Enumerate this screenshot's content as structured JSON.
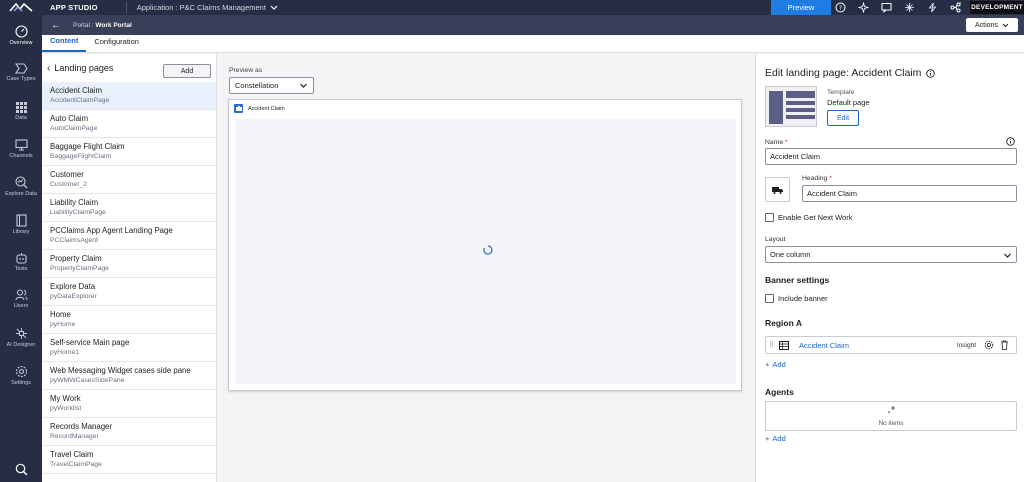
{
  "topbar": {
    "studio": "APP STUDIO",
    "application": "Application : P&C Claims Management",
    "preview": "Preview",
    "environment": "DEVELOPMENT"
  },
  "leftnav": [
    {
      "label": "Overview",
      "icon": "overview-icon"
    },
    {
      "label": "Case Types",
      "icon": "case-types-icon"
    },
    {
      "label": "Data",
      "icon": "data-icon"
    },
    {
      "label": "Channels",
      "icon": "channels-icon"
    },
    {
      "label": "Explore Data",
      "icon": "explore-data-icon"
    },
    {
      "label": "Library",
      "icon": "library-icon"
    },
    {
      "label": "Tests",
      "icon": "tests-icon"
    },
    {
      "label": "Users",
      "icon": "users-icon"
    },
    {
      "label": "AI Designer",
      "icon": "ai-designer-icon"
    },
    {
      "label": "Settings",
      "icon": "settings-icon"
    }
  ],
  "subheader": {
    "portal_prefix": "Portal : ",
    "portal_name": "Work Portal",
    "actions": "Actions"
  },
  "tabs": [
    {
      "label": "Content",
      "active": true
    },
    {
      "label": "Configuration",
      "active": false
    }
  ],
  "landing_pages": {
    "title": "Landing pages",
    "add": "Add",
    "items": [
      {
        "name": "Accident Claim",
        "id": "AccidentClaimPage"
      },
      {
        "name": "Auto Claim",
        "id": "AutoClaimPage"
      },
      {
        "name": "Baggage Flight Claim",
        "id": "BaggageFlightClaim"
      },
      {
        "name": "Customer",
        "id": "Customer_2"
      },
      {
        "name": "Liability Claim",
        "id": "LiabilityClaimPage"
      },
      {
        "name": "PCClaims App Agent Landing Page",
        "id": "PCClaimsAgent"
      },
      {
        "name": "Property Claim",
        "id": "PropertyClaimPage"
      },
      {
        "name": "Explore Data",
        "id": "pyDataExplorer"
      },
      {
        "name": "Home",
        "id": "pyHome"
      },
      {
        "name": "Self-service Main page",
        "id": "pyHome1"
      },
      {
        "name": "Web Messaging Widget cases side pane",
        "id": "pyWMWCasesSidePane"
      },
      {
        "name": "My Work",
        "id": "pyWorklist"
      },
      {
        "name": "Records Manager",
        "id": "RecordManager"
      },
      {
        "name": "Travel Claim",
        "id": "TravelClaimPage"
      }
    ]
  },
  "preview": {
    "label": "Preview as",
    "selected": "Constellation",
    "frame_title": "Accident Claim"
  },
  "edit": {
    "title": "Edit landing page: Accident Claim",
    "template_label": "Template",
    "template_value": "Default page",
    "template_edit": "Edit",
    "name_label": "Name",
    "name_value": "Accident Claim",
    "heading_label": "Heading",
    "heading_value": "Accident Claim",
    "get_next_work": "Enable Get Next Work",
    "layout_label": "Layout",
    "layout_value": "One column",
    "banner_settings": "Banner settings",
    "include_banner": "Include banner",
    "region_a": "Region A",
    "region_item": "Accident Claim",
    "region_item_tag": "Insight",
    "add": "Add",
    "agents": "Agents",
    "no_items": "No items"
  },
  "colors": {
    "nav_bg": "#262d44",
    "accent": "#1f65c8",
    "preview_btn": "#1f7ce2"
  }
}
